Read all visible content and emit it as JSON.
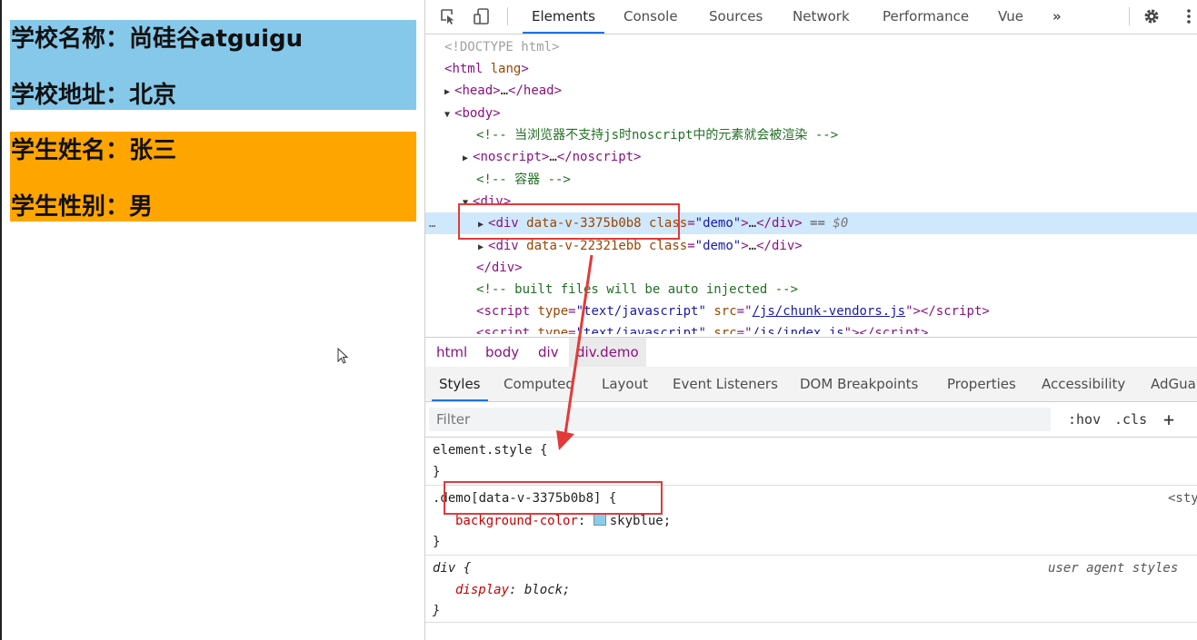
{
  "preview": {
    "school": {
      "name_line": "学校名称：尚硅谷atguigu",
      "address_line": "学校地址：北京",
      "background": "#85c8ea"
    },
    "student": {
      "name_line": "学生姓名：张三",
      "gender_line": "学生性别：男",
      "background": "#ffa500"
    }
  },
  "toolbar": {
    "tabs": [
      "Elements",
      "Console",
      "Sources",
      "Network",
      "Performance",
      "Vue"
    ],
    "more": "»",
    "active_tab": "Elements"
  },
  "dom": {
    "doctype": "<!DOCTYPE html>",
    "html_open": "html",
    "html_attr": "lang",
    "head_open": "head",
    "head_ellipsis": "…",
    "head_close": "/head",
    "body_open": "body",
    "comment1": "<!-- 当浏览器不支持js时noscript中的元素就会被渲染 -->",
    "noscript_open": "noscript",
    "noscript_ellipsis": "…",
    "noscript_close": "/noscript",
    "comment2": "<!-- 容器 -->",
    "div_open": "div",
    "sel_tag": "div",
    "sel_attr1": "data-v-3375b0b8",
    "sel_attr2": "class",
    "sel_val": "\"demo\"",
    "sel_ellipsis": "…",
    "sel_close": "/div",
    "sel_eq": "==",
    "sel_ref": "$0",
    "dots": "…",
    "div2_tag": "div",
    "div2_attr1": "data-v-22321ebb",
    "div2_attr2": "class",
    "div2_val": "\"demo\"",
    "div2_ellipsis": "…",
    "div2_close": "/div",
    "div_close": "/div",
    "comment3": "<!-- built files will be auto injected -->",
    "script_tag": "script",
    "script_type_attr": "type",
    "script_type_val": "\"text/javascript\"",
    "script_src_attr": "src",
    "script1_src": "/js/chunk-vendors.js",
    "script_close": "/script",
    "script2_src": "/js/index.js"
  },
  "breadcrumb": [
    "html",
    "body",
    "div",
    "div.demo"
  ],
  "styles_tabs": [
    "Styles",
    "Computed",
    "Layout",
    "Event Listeners",
    "DOM Breakpoints",
    "Properties",
    "Accessibility",
    "AdGua"
  ],
  "filter": {
    "placeholder": "Filter",
    "hov": ":hov",
    "cls": ".cls",
    "plus": "+"
  },
  "rules": {
    "element_style": {
      "selector": "element.style {",
      "close": "}"
    },
    "demo": {
      "selector": ".demo[data-v-3375b0b8] {",
      "property": "background-color",
      "value": "skyblue",
      "swatch_color": "#87ceeb",
      "source": "<sty",
      "close": "}"
    },
    "ua_div": {
      "selector": "div {",
      "property": "display",
      "value": "block",
      "source": "user agent styles",
      "close": "}"
    }
  }
}
